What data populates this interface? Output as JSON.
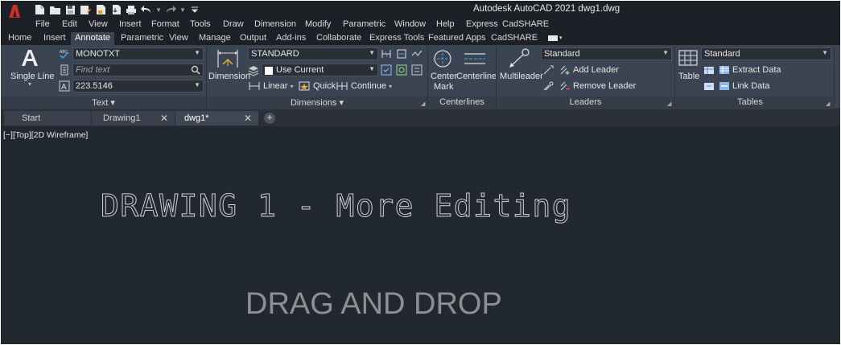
{
  "app": {
    "title": "Autodesk AutoCAD 2021    dwg1.dwg",
    "logo_letter": "A",
    "qat_icons": [
      "new-file-icon",
      "open-folder-icon",
      "save-icon",
      "save-as-icon",
      "web-open-icon",
      "web-save-icon",
      "plot-icon",
      "undo-icon",
      "redo-icon",
      "qat-customize-icon"
    ]
  },
  "menu": [
    "File",
    "Edit",
    "View",
    "Insert",
    "Format",
    "Tools",
    "Draw",
    "Dimension",
    "Modify",
    "Parametric",
    "Window",
    "Help",
    "Express",
    "CadSHARE"
  ],
  "ribbon_tabs": [
    "Home",
    "Insert",
    "Annotate",
    "Parametric",
    "View",
    "Manage",
    "Output",
    "Add-ins",
    "Collaborate",
    "Express Tools",
    "Featured Apps",
    "CadSHARE"
  ],
  "active_ribbon_tab": "Annotate",
  "panels": {
    "text": {
      "title": "Text",
      "single_line": "Single Line",
      "style": "MONOTXT",
      "find_placeholder": "Find text",
      "height": "223.5146"
    },
    "dimensions": {
      "title": "Dimensions",
      "dimension_label": "Dimension",
      "style": "STANDARD",
      "layer": "Use Current",
      "linear": "Linear",
      "quick": "Quick",
      "continue": "Continue"
    },
    "centerlines": {
      "title": "Centerlines",
      "center_mark_1": "Center",
      "center_mark_2": "Mark",
      "centerline": "Centerline"
    },
    "leaders": {
      "title": "Leaders",
      "multileader": "Multileader",
      "style": "Standard",
      "add_leader": "Add Leader",
      "remove_leader": "Remove Leader"
    },
    "tables": {
      "title": "Tables",
      "table": "Table",
      "style": "Standard",
      "extract_data": "Extract Data",
      "link_data": "Link Data"
    }
  },
  "doc_tabs": [
    {
      "label": "Start",
      "closable": false
    },
    {
      "label": "Drawing1",
      "closable": true
    },
    {
      "label": "dwg1*",
      "closable": true,
      "active": true
    }
  ],
  "add_tab_label": "+",
  "viewport_label": "[−][Top][2D Wireframe]",
  "drawing": {
    "shx_text": "DRAWING 1 - More Editing",
    "ttf_text": "DRAG AND DROP"
  },
  "colors": {
    "accent_red": "#c8302a",
    "ribbon_bg": "#3b4452",
    "canvas_bg": "#212830",
    "titlebar_bg": "#1d2026"
  }
}
